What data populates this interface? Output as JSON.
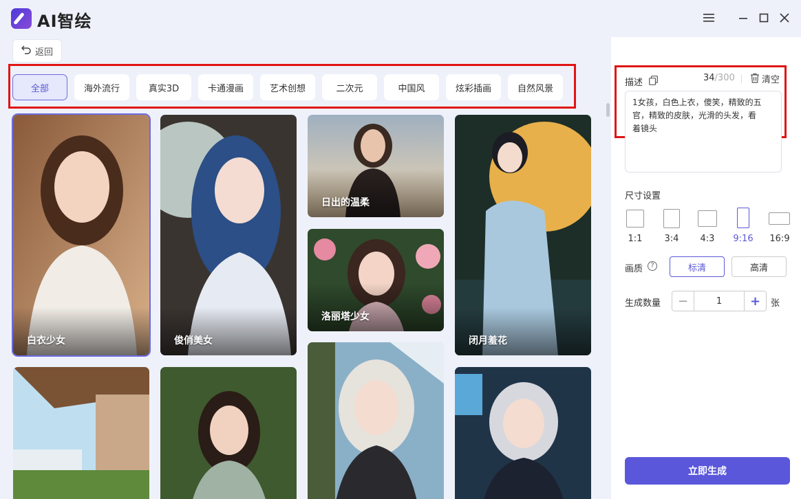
{
  "app": {
    "title": "AI智绘"
  },
  "toolbar": {
    "back_label": "返回"
  },
  "categories": [
    {
      "label": "全部",
      "active": true
    },
    {
      "label": "海外流行"
    },
    {
      "label": "真实3D"
    },
    {
      "label": "卡通漫画"
    },
    {
      "label": "艺术创想"
    },
    {
      "label": "二次元"
    },
    {
      "label": "中国风"
    },
    {
      "label": "炫彩插画"
    },
    {
      "label": "自然风景"
    }
  ],
  "gallery": [
    {
      "label": "白衣少女",
      "selected": true
    },
    {
      "label": "俊俏美女"
    },
    {
      "label": "日出的温柔"
    },
    {
      "label": "洛丽塔少女"
    },
    {
      "label": "闭月羞花"
    },
    {
      "label": ""
    },
    {
      "label": ""
    },
    {
      "label": ""
    },
    {
      "label": ""
    }
  ],
  "panel": {
    "desc_label": "描述",
    "count_current": "34",
    "count_max": "/300",
    "clear_label": "清空",
    "desc_lines": [
      "1女孩，白色上衣，傻笑，精致的五",
      "官，精致的皮肤，光滑的头发，看",
      "着镜头"
    ],
    "size_label": "尺寸设置",
    "ratios": [
      {
        "label": "1:1"
      },
      {
        "label": "3:4"
      },
      {
        "label": "4:3"
      },
      {
        "label": "9:16",
        "active": true
      },
      {
        "label": "16:9"
      }
    ],
    "quality_label": "画质",
    "quality_help": "?",
    "quality_options": [
      {
        "label": "标清",
        "active": true
      },
      {
        "label": "高清"
      }
    ],
    "count_label": "生成数量",
    "stepper_value": "1",
    "stepper_minus": "−",
    "stepper_plus": "+",
    "unit": "张",
    "generate_label": "立即生成"
  },
  "colors": {
    "accent": "#5b57db",
    "highlight_outline": "#e01414",
    "left_bg": "#eef1fa"
  }
}
